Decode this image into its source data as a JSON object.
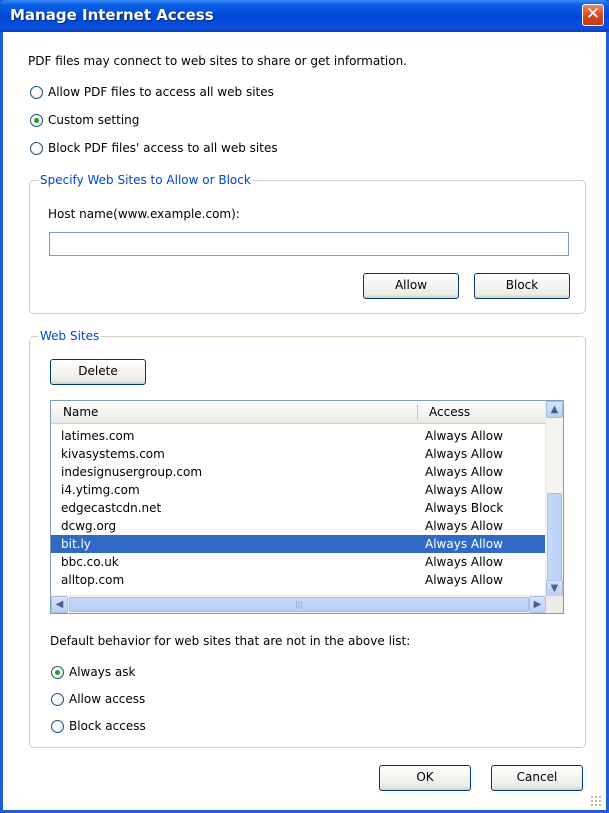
{
  "window": {
    "title": "Manage Internet Access",
    "close_label": "✕"
  },
  "intro_text": "PDF files may connect to web sites to share or get information.",
  "access_options": [
    {
      "label": "Allow PDF files to access all web sites",
      "selected": false
    },
    {
      "label": "Custom setting",
      "selected": true
    },
    {
      "label": "Block PDF files' access to all web sites",
      "selected": false
    }
  ],
  "specify_group": {
    "title": "Specify Web Sites to Allow or Block",
    "host_label": "Host name(www.example.com):",
    "host_value": "",
    "allow_label": "Allow",
    "block_label": "Block"
  },
  "websites_group": {
    "title": "Web Sites",
    "delete_label": "Delete",
    "columns": {
      "name": "Name",
      "access": "Access"
    },
    "rows": [
      {
        "name": "latimes.com",
        "access": "Always Allow",
        "selected": false
      },
      {
        "name": "kivasystems.com",
        "access": "Always Allow",
        "selected": false
      },
      {
        "name": "indesignusergroup.com",
        "access": "Always Allow",
        "selected": false
      },
      {
        "name": "i4.ytimg.com",
        "access": "Always Allow",
        "selected": false
      },
      {
        "name": "edgecastcdn.net",
        "access": "Always Block",
        "selected": false
      },
      {
        "name": "dcwg.org",
        "access": "Always Allow",
        "selected": false
      },
      {
        "name": "bit.ly",
        "access": "Always Allow",
        "selected": true
      },
      {
        "name": "bbc.co.uk",
        "access": "Always Allow",
        "selected": false
      },
      {
        "name": "alltop.com",
        "access": "Always Allow",
        "selected": false
      }
    ],
    "default_label": "Default behavior for web sites that are not in the above list:",
    "default_options": [
      {
        "label": "Always ask",
        "selected": true
      },
      {
        "label": "Allow access",
        "selected": false
      },
      {
        "label": "Block access",
        "selected": false
      }
    ]
  },
  "footer": {
    "ok_label": "OK",
    "cancel_label": "Cancel"
  }
}
